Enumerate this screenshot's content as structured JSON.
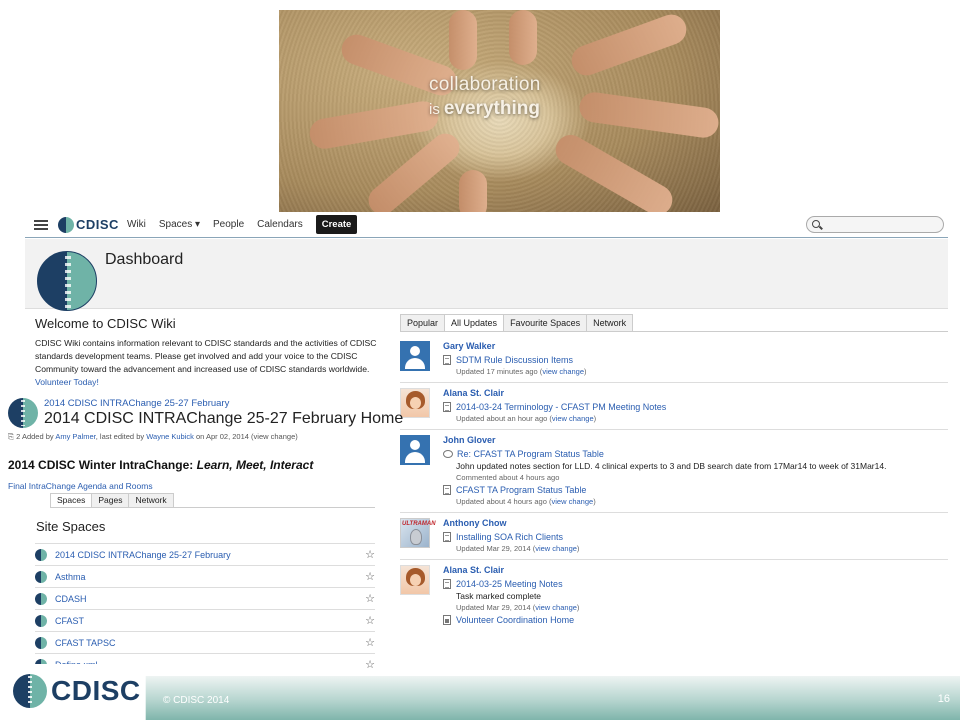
{
  "hero": {
    "caption_line1": "collaboration",
    "caption_is": "is",
    "caption_everything": "everything"
  },
  "topnav": {
    "logo_text": "CDISC",
    "items": [
      "Wiki",
      "Spaces ▾",
      "People",
      "Calendars"
    ],
    "create_label": "Create",
    "search_placeholder": ""
  },
  "dashboard": {
    "title": "Dashboard"
  },
  "welcome": {
    "title": "Welcome to CDISC Wiki",
    "text": "CDISC Wiki contains information relevant to CDISC standards and the activities of CDISC standards development teams.  Please get involved and add your voice to the CDISC Community toward the advancement and increased use of CDISC standards worldwide.",
    "link": "Volunteer Today!"
  },
  "updates": {
    "tabs": [
      "Popular",
      "All Updates",
      "Favourite Spaces",
      "Network"
    ],
    "active_tab": "All Updates",
    "items": [
      {
        "user": "Gary Walker",
        "avatar": "blue",
        "entries": [
          {
            "icon": "doc",
            "title": "SDTM Rule Discussion Items",
            "detail": "",
            "meta": "Updated 17 minutes ago (",
            "meta_link": "view change",
            "meta_end": ")"
          }
        ]
      },
      {
        "user": "Alana St. Clair",
        "avatar": "girl",
        "entries": [
          {
            "icon": "doc",
            "title": "2014-03-24 Terminology - CFAST PM Meeting Notes",
            "detail": "",
            "meta": "Updated about an hour ago (",
            "meta_link": "view change",
            "meta_end": ")"
          }
        ]
      },
      {
        "user": "John Glover",
        "avatar": "blue",
        "entries": [
          {
            "icon": "comment",
            "title": "Re: CFAST TA Program Status Table",
            "detail": "John updated notes section for LLD.  4 clinical experts to 3 and DB search date from 17Mar14 to week of 31Mar14.",
            "meta": "Commented about 4 hours ago",
            "meta_link": "",
            "meta_end": ""
          },
          {
            "icon": "doc",
            "title": "CFAST TA Program Status Table",
            "detail": "",
            "meta": "Updated about 4 hours ago (",
            "meta_link": "view change",
            "meta_end": ")"
          }
        ]
      },
      {
        "user": "Anthony Chow",
        "avatar": "ultra",
        "avatar_text": "ULTRAMAN",
        "entries": [
          {
            "icon": "doc",
            "title": "Installing SOA Rich Clients",
            "detail": "",
            "meta": "Updated Mar 29, 2014 (",
            "meta_link": "view change",
            "meta_end": ")"
          }
        ]
      },
      {
        "user": "Alana St. Clair",
        "avatar": "girl",
        "entries": [
          {
            "icon": "doc",
            "title": "2014-03-25 Meeting Notes",
            "detail": "Task marked complete",
            "meta": "Updated Mar 29, 2014 (",
            "meta_link": "view change",
            "meta_end": ")"
          },
          {
            "icon": "home",
            "title": "Volunteer Coordination Home",
            "detail": "",
            "meta": "",
            "meta_link": "",
            "meta_end": ""
          }
        ]
      }
    ]
  },
  "intrachange": {
    "breadcrumb": "2014 CDISC INTRAChange 25-27 February",
    "title": "2014 CDISC INTRAChange 25-27 February Home",
    "meta_count": "2",
    "meta_added": "Added by",
    "meta_author": "Amy Palmer",
    "meta_edited": ", last edited by",
    "meta_editor": "Wayne Kubick",
    "meta_date": "on Apr 02, 2014",
    "meta_view": "(view change)",
    "heading_plain": "2014 CDISC Winter IntraChange: ",
    "heading_italic": "Learn, Meet, Interact",
    "link": "Final IntraChange Agenda and Rooms"
  },
  "site_spaces": {
    "tabs": [
      "Spaces",
      "Pages",
      "Network"
    ],
    "title": "Site Spaces",
    "items": [
      "2014 CDISC INTRAChange 25-27 February",
      "Asthma",
      "CDASH",
      "CFAST",
      "CFAST TAPSC",
      "Define.xml"
    ]
  },
  "footer": {
    "logo_text": "CDISC",
    "copyright": "© CDISC 2014",
    "page_number": "16"
  }
}
